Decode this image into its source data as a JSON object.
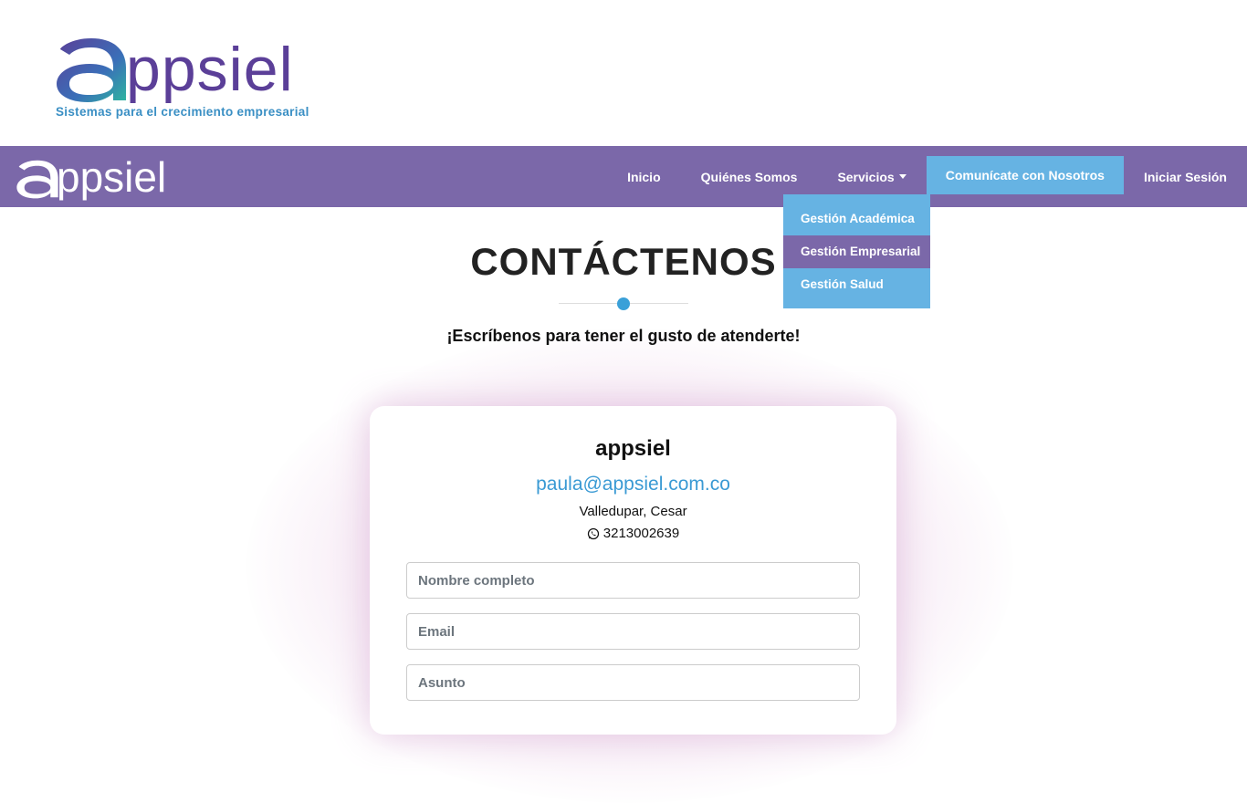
{
  "header": {
    "logo_word": "ppsiel",
    "tagline": "Sistemas para el crecimiento empresarial"
  },
  "navbar": {
    "logo_word": "ppsiel",
    "items": [
      {
        "label": "Inicio"
      },
      {
        "label": "Quiénes Somos"
      },
      {
        "label": "Servicios"
      },
      {
        "label": "Comunícate con Nosotros"
      },
      {
        "label": "Iniciar Sesión"
      }
    ],
    "dropdown": [
      {
        "label": "Gestión Académica"
      },
      {
        "label": "Gestión Empresarial"
      },
      {
        "label": "Gestión Salud"
      }
    ]
  },
  "page": {
    "title": "CONTÁCTENOS",
    "subtitle": "¡Escríbenos para tener el gusto de atenderte!"
  },
  "contact": {
    "name": "appsiel",
    "email": "paula@appsiel.com.co",
    "city": "Valledupar, Cesar",
    "phone": "3213002639"
  },
  "form": {
    "name_placeholder": "Nombre completo",
    "email_placeholder": "Email",
    "subject_placeholder": "Asunto"
  },
  "colors": {
    "brand_purple": "#7b68a9",
    "accent_blue": "#66b3e3",
    "link_blue": "#3a9ad4"
  }
}
